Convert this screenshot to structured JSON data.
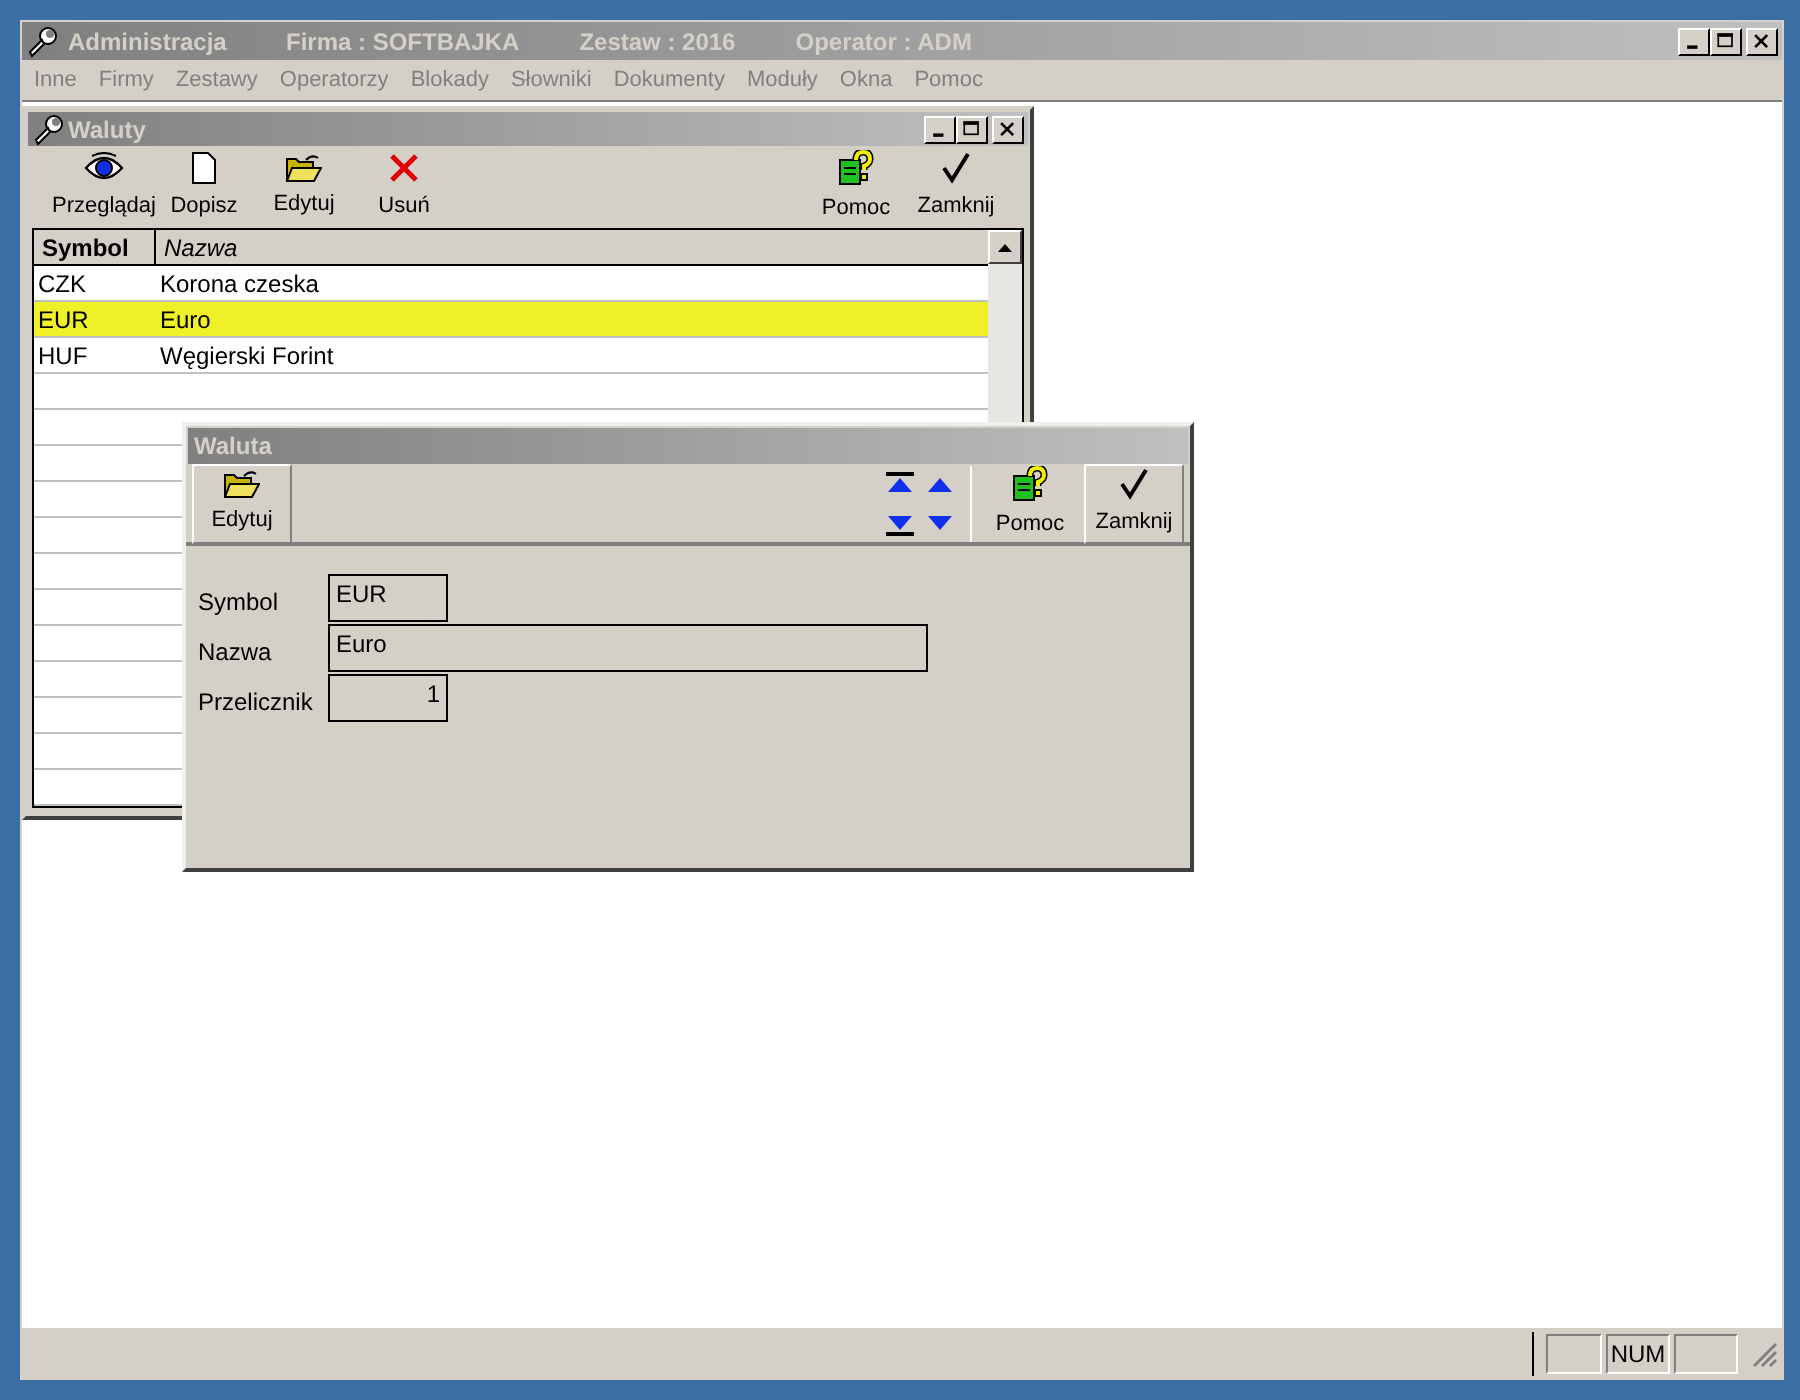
{
  "window": {
    "title": "Administracja",
    "info": [
      "Firma : SOFTBAJKA",
      "Zestaw : 2016",
      "Operator : ADM"
    ]
  },
  "menu": [
    {
      "label": "Inne",
      "disabled": true
    },
    {
      "label": "Firmy",
      "disabled": true
    },
    {
      "label": "Zestawy",
      "disabled": true
    },
    {
      "label": "Operatorzy",
      "disabled": true
    },
    {
      "label": "Blokady",
      "disabled": true
    },
    {
      "label": "Słowniki",
      "disabled": true
    },
    {
      "label": "Dokumenty",
      "disabled": true
    },
    {
      "label": "Moduły",
      "disabled": true
    },
    {
      "label": "Okna",
      "disabled": true
    },
    {
      "label": "Pomoc",
      "disabled": true
    }
  ],
  "list_window": {
    "title": "Waluty",
    "toolbar_left": [
      {
        "label": "Przeglądaj"
      },
      {
        "label": "Dopisz"
      },
      {
        "label": "Edytuj"
      },
      {
        "label": "Usuń"
      }
    ],
    "toolbar_right": [
      {
        "label": "Pomoc"
      },
      {
        "label": "Zamknij"
      }
    ],
    "table": {
      "columns": [
        {
          "label": "Symbol",
          "kind": "bold"
        },
        {
          "label": "Nazwa",
          "kind": "italic"
        }
      ],
      "rows": [
        {
          "cells": [
            "CZK",
            "Korona czeska"
          ],
          "selected": false
        },
        {
          "cells": [
            "EUR",
            "Euro"
          ],
          "selected": true
        },
        {
          "cells": [
            "HUF",
            "Węgierski Forint"
          ],
          "selected": false
        }
      ]
    }
  },
  "dialog": {
    "title": "Waluta",
    "toolbar_left": [
      {
        "label": "Edytuj",
        "raised": true
      }
    ],
    "toolbar_right": [
      {
        "label": "Pomoc",
        "raised": false
      },
      {
        "label": "Zamknij",
        "raised": true
      }
    ],
    "fields": [
      {
        "label": "Symbol",
        "value": "EUR",
        "kind": "short"
      },
      {
        "label": "Nazwa",
        "value": "Euro",
        "kind": "wide"
      },
      {
        "label": "Przelicznik",
        "value": "1",
        "kind": "number"
      }
    ]
  },
  "status_bar": {
    "num": "NUM"
  }
}
